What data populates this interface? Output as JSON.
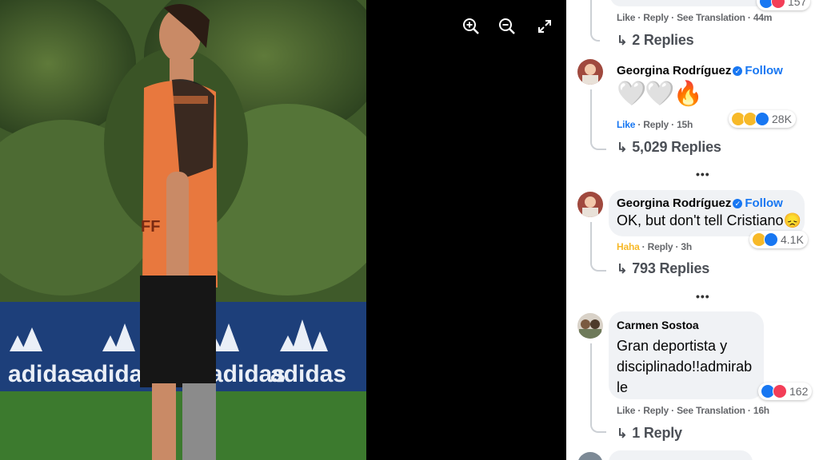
{
  "viewer": {
    "controls": {
      "zoom_in_icon": "zoom-in-icon",
      "zoom_out_icon": "zoom-out-icon",
      "fullscreen_icon": "fullscreen-icon"
    },
    "photo_text": {
      "banner_brand": "adidas",
      "bib_text": "FF"
    }
  },
  "colors": {
    "link_blue": "#1877f2",
    "haha_yellow": "#f7b928",
    "bubble_gray": "#f0f2f5",
    "meta_gray": "#65676b"
  },
  "comments": [
    {
      "meta": {
        "like": "Like",
        "reply": "Reply",
        "translate": "See Translation",
        "time": "44m"
      },
      "partial_count": "157",
      "replies": "2 Replies"
    },
    {
      "author": "Georgina Rodríguez",
      "verified": true,
      "follow": "Follow",
      "text": "🤍🤍🔥",
      "meta": {
        "like": "Like",
        "reply": "Reply",
        "time": "15h"
      },
      "reaction_count": "28K",
      "replies": "5,029 Replies"
    },
    {
      "author": "Georgina Rodríguez",
      "verified": true,
      "follow": "Follow",
      "text": "OK, but don't tell Cristiano😞",
      "meta": {
        "like": "Haha",
        "reply": "Reply",
        "time": "3h"
      },
      "reaction_count": "4.1K",
      "replies": "793 Replies"
    },
    {
      "author": "Carmen Sostoa",
      "text_lines": [
        "Gran deportista y",
        "disciplinado!!admirab",
        "le"
      ],
      "meta": {
        "like": "Like",
        "reply": "Reply",
        "translate": "See Translation",
        "time": "16h"
      },
      "reaction_count": "162",
      "replies": "1 Reply"
    }
  ],
  "more_dots": "•••"
}
